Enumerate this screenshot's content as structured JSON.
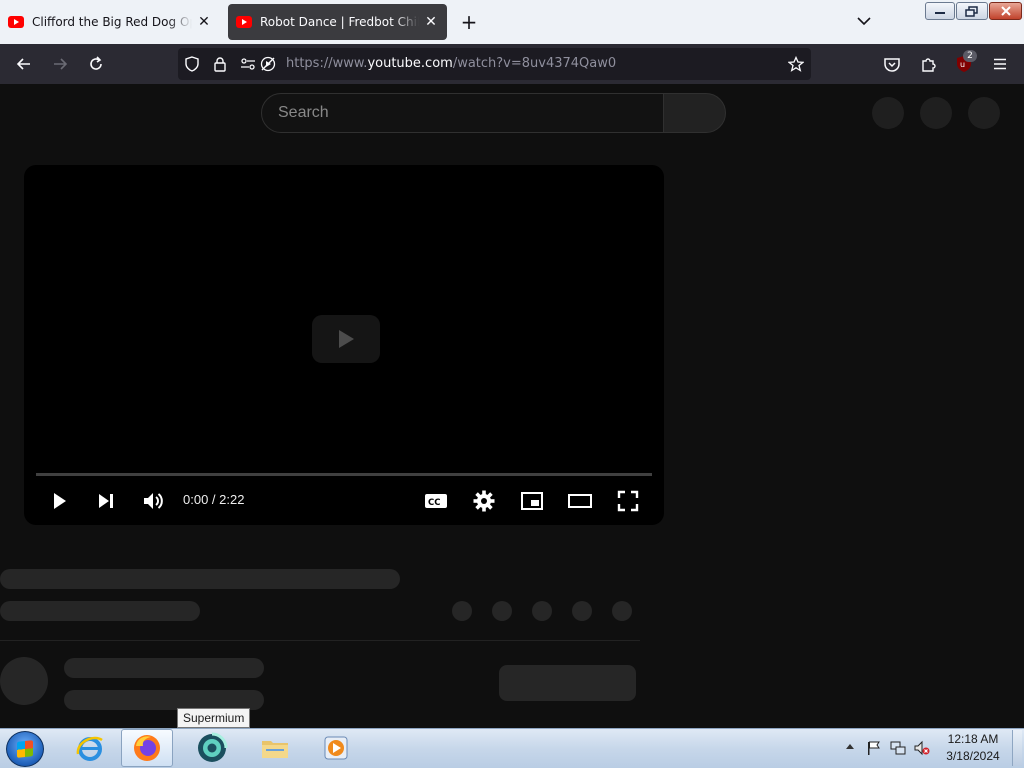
{
  "browser": {
    "tabs": [
      {
        "title": "Clifford the Big Red Dog Opening",
        "active": false
      },
      {
        "title": "Robot Dance | Fredbot Children's",
        "active": true
      }
    ],
    "url": {
      "prefix": "https://www.",
      "host": "youtube.com",
      "path": "/watch?v=8uv4374Qaw0"
    },
    "extension_badge": "2"
  },
  "youtube": {
    "search_placeholder": "Search",
    "player": {
      "time": "0:00 / 2:22",
      "progress_fraction": 0
    }
  },
  "tooltip": "Supermium",
  "taskbar": {
    "apps": [
      "internet-explorer",
      "firefox",
      "supermium",
      "file-explorer",
      "media-player"
    ],
    "clock_time": "12:18 AM",
    "clock_date": "3/18/2024"
  },
  "colors": {
    "youtube_bg": "#0f0f0f",
    "firefox_toolbar": "#2b2a33",
    "youtube_red": "#ff0000"
  }
}
